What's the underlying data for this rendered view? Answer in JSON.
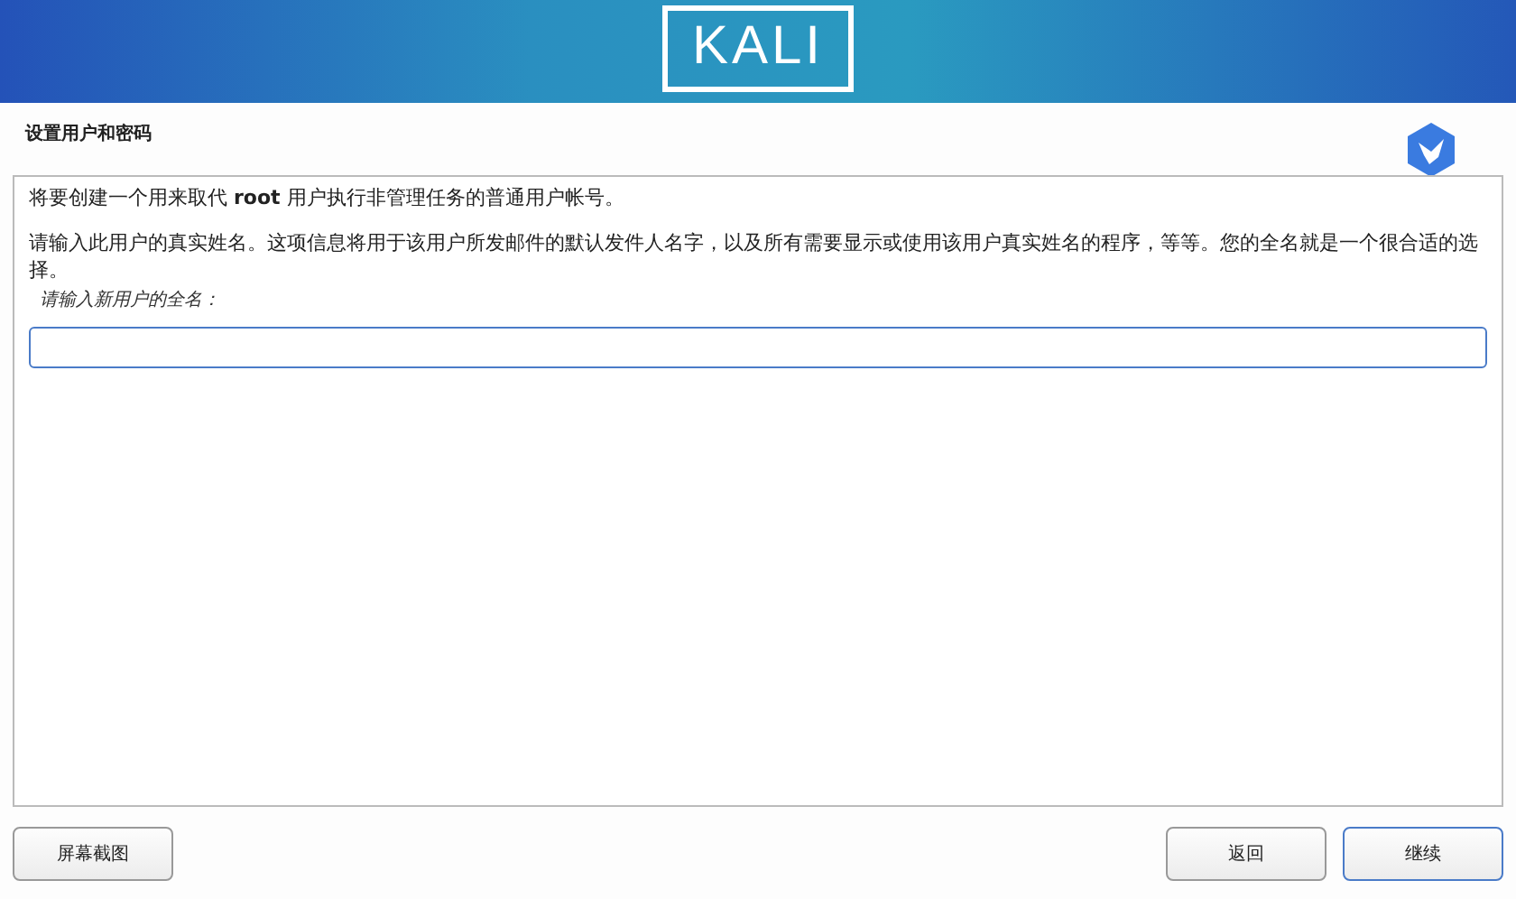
{
  "header": {
    "logo": "KALI"
  },
  "title": "设置用户和密码",
  "paragraphs": [
    "将要创建一个用来取代 **root** 用户执行非管理任务的普通用户帐号。",
    "请输入此用户的真实姓名。这项信息将用于该用户所发邮件的默认发件人名字，以及所有需要显示或使用该用户真实姓名的程序，等等。您的全名就是一个很合适的选择。"
  ],
  "field": {
    "label": "请输入新用户的全名："
  },
  "left_buttons": [
    {
      "label": "屏幕截图",
      "default": false
    }
  ],
  "right_buttons": [
    {
      "label": "返回",
      "default": false
    },
    {
      "label": "继续",
      "default": true
    }
  ]
}
